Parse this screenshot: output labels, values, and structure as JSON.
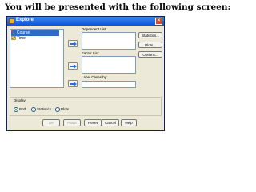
{
  "caption": "You will be presented with the following screen:",
  "dialog": {
    "title": "Explore",
    "variables": [
      {
        "name": "Course",
        "icon": "nominal-variable-icon",
        "selected": true
      },
      {
        "name": "Time",
        "icon": "scale-variable-icon",
        "selected": false
      }
    ],
    "dependent_list_label": "Dependent List:",
    "factor_list_label": "Factor List:",
    "label_cases_label": "Label Cases by:",
    "side_buttons": [
      "Statistics...",
      "Plots...",
      "Options..."
    ],
    "display": {
      "label": "Display",
      "options": [
        "Both",
        "Statistics",
        "Plots"
      ],
      "selected": "Both"
    },
    "bottom_buttons": [
      "OK",
      "Paste",
      "Reset",
      "Cancel",
      "Help"
    ],
    "disabled_buttons": [
      "OK",
      "Paste"
    ]
  },
  "colors": {
    "titlebar": "#0a54d8",
    "dialog_bg": "#ece9d8",
    "selection": "#316ac5",
    "arrow": "#2a6fd6"
  }
}
